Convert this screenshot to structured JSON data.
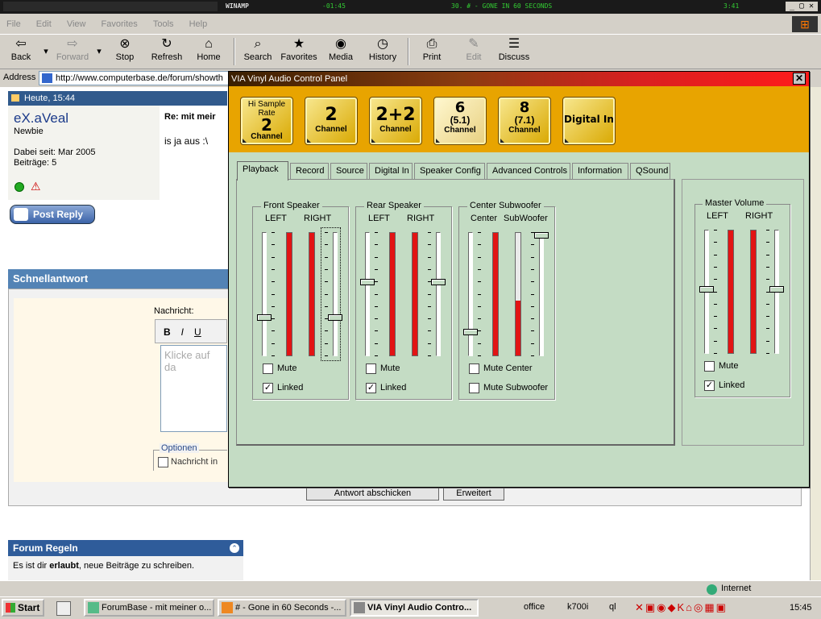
{
  "taskbar_top": {
    "winamp_title": "WINAMP",
    "winamp_time": "-01:45",
    "track": "30. # - GONE IN 60 SECONDS",
    "track_time": "3:41"
  },
  "ie": {
    "menu": [
      "File",
      "Edit",
      "View",
      "Favorites",
      "Tools",
      "Help"
    ],
    "toolbar": {
      "back": "Back",
      "forward": "Forward",
      "stop": "Stop",
      "refresh": "Refresh",
      "home": "Home",
      "search": "Search",
      "favorites": "Favorites",
      "media": "Media",
      "history": "History",
      "print": "Print",
      "edit": "Edit",
      "discuss": "Discuss"
    },
    "address_label": "Address",
    "address_value": "http://www.computerbase.de/forum/showth"
  },
  "forum": {
    "post_date": "Heute, 15:44",
    "username": "eX.aVeal",
    "rank": "Newbie",
    "joined": "Dabei seit: Mar 2005",
    "posts": "Beiträge: 5",
    "msg_title": "Re: mit meir",
    "msg_body": "is ja aus :\\",
    "post_reply": "Post Reply",
    "schnell_title": "Schnellantwort",
    "nachricht_label": "Nachricht:",
    "bold": "B",
    "italic": "I",
    "underline": "U",
    "textarea_placeholder": "Klicke auf da",
    "options_legend": "Optionen",
    "options_check": "Nachricht in",
    "submit": "Antwort abschicken",
    "advanced": "Erweitert",
    "rules_title": "Forum Regeln",
    "rules_line1_pre": "Es ist dir ",
    "rules_line1_bold": "erlaubt",
    "rules_line1_post": ", neue Beiträge zu schreiben."
  },
  "status": {
    "zone": "Internet"
  },
  "taskbar": {
    "start": "Start",
    "tasks": [
      "ForumBase - mit meiner o...",
      "# - Gone in 60 Seconds -...",
      "VIA Vinyl Audio Contro..."
    ],
    "quick": [
      "office",
      "k700i",
      "ql"
    ],
    "clock": "15:45"
  },
  "via": {
    "title": "VIA Vinyl Audio Control Panel",
    "close": "✕",
    "channels": [
      {
        "top": "Hi Sample Rate",
        "big": "2",
        "bottom": "Channel"
      },
      {
        "top": "",
        "big": "2",
        "bottom": "Channel"
      },
      {
        "top": "",
        "big": "2+2",
        "bottom": "Channel"
      },
      {
        "top": "",
        "big": "6",
        "mid": "(5.1)",
        "bottom": "Channel"
      },
      {
        "top": "",
        "big": "8",
        "mid": "(7.1)",
        "bottom": "Channel"
      },
      {
        "top": "",
        "big": "Digital In",
        "bottom": ""
      }
    ],
    "tabs": [
      "Playback",
      "Record",
      "Source",
      "Digital In",
      "Speaker Config",
      "Advanced Controls",
      "Information",
      "QSound"
    ],
    "groups": {
      "front": {
        "title": "Front Speaker",
        "left": "LEFT",
        "right": "RIGHT",
        "mute": "Mute",
        "linked": "Linked"
      },
      "rear": {
        "title": "Rear Speaker",
        "left": "LEFT",
        "right": "RIGHT",
        "mute": "Mute",
        "linked": "Linked"
      },
      "center": {
        "title": "Center Subwoofer",
        "left": "Center",
        "right": "SubWoofer",
        "mute1": "Mute Center",
        "mute2": "Mute Subwoofer"
      },
      "master": {
        "title": "Master Volume",
        "left": "LEFT",
        "right": "RIGHT",
        "mute": "Mute",
        "linked": "Linked"
      }
    },
    "levels": {
      "front_left_slider": 0.7,
      "front_right_slider": 0.7,
      "front_left_meter": 1.0,
      "front_right_meter": 1.0,
      "rear_left_slider": 0.4,
      "rear_right_slider": 0.4,
      "rear_left_meter": 1.0,
      "rear_right_meter": 1.0,
      "center_slider": 0.82,
      "sub_slider": 0.0,
      "center_meter": 1.0,
      "sub_meter": 0.45,
      "master_left_slider": 0.48,
      "master_right_slider": 0.48,
      "master_left_meter": 1.0,
      "master_right_meter": 1.0
    },
    "checks": {
      "front_mute": false,
      "front_linked": true,
      "rear_mute": false,
      "rear_linked": true,
      "mute_center": false,
      "mute_sub": false,
      "master_mute": false,
      "master_linked": true
    }
  }
}
